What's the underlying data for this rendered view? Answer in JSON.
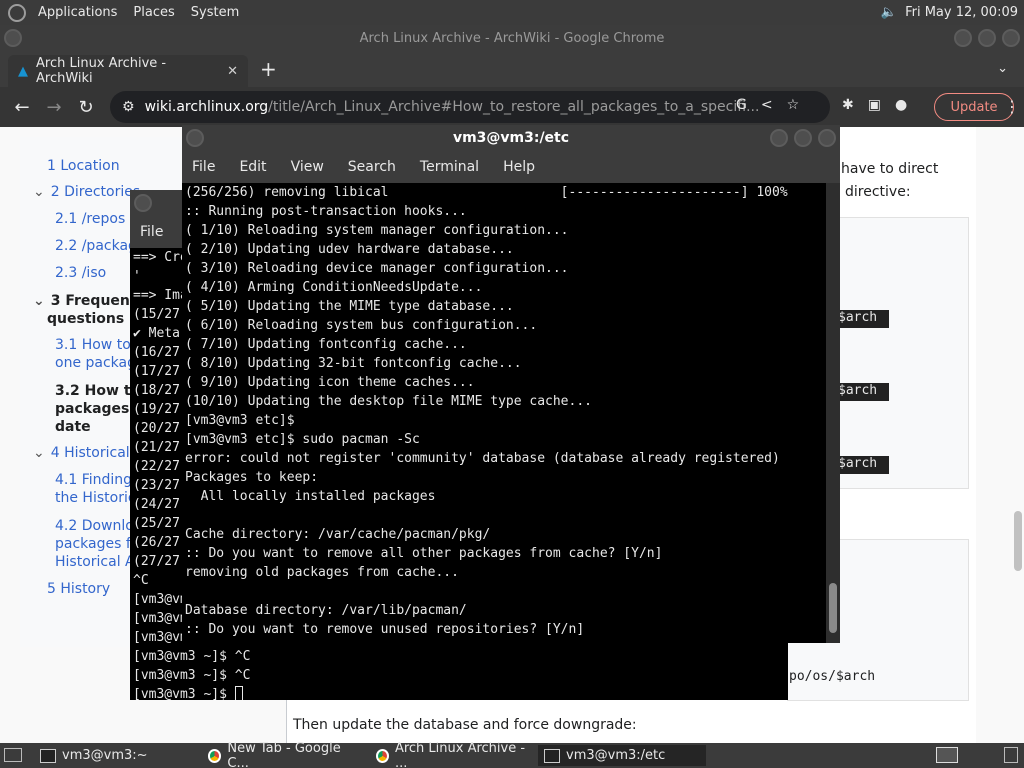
{
  "top_panel": {
    "applications": "Applications",
    "places": "Places",
    "system": "System",
    "clock": "Fri May 12, 00:09"
  },
  "chrome": {
    "window_title": "Arch Linux Archive - ArchWiki - Google Chrome",
    "tab_title": "Arch Linux Archive - ArchWiki",
    "url_host": "wiki.archlinux.org",
    "url_path": "/title/Arch_Linux_Archive#How_to_restore_all_packages_to_a_specifi...",
    "update_label": "Update"
  },
  "toc": [
    {
      "label": "1  Location"
    },
    {
      "label": "2  Directories"
    },
    {
      "label": "2.1  /repos"
    },
    {
      "label": "2.2  /packag"
    },
    {
      "label": "2.3  /iso"
    },
    {
      "label": "3  Frequently"
    },
    {
      "label": "questions"
    },
    {
      "label": "3.1  How to"
    },
    {
      "label": "one packag"
    },
    {
      "label": "3.2  How to"
    },
    {
      "label": "packages t"
    },
    {
      "label": "date"
    },
    {
      "label": "4  Historical A"
    },
    {
      "label": "4.1  Finding"
    },
    {
      "label": "the Historica"
    },
    {
      "label": "4.2  Downlo"
    },
    {
      "label": "packages fr"
    },
    {
      "label": "Historical Ar"
    },
    {
      "label": "5  History"
    }
  ],
  "content": {
    "text1": "have to direct",
    "text2": "directive:",
    "arch1": "$arch",
    "arch2": "$arch",
    "arch3": "$arch",
    "repo_line": "po/os/$arch",
    "bottom_text": "Then update the database and force downgrade:"
  },
  "term_back": {
    "menu_file": "File",
    "lines": [
      "==> Cre",
      "'",
      "==> Ima",
      "(15/27",
      "✔ Meta",
      "(16/27",
      "(17/27",
      "(18/27",
      "(19/27",
      "(20/27",
      "(21/27",
      "(22/27",
      "(23/27",
      "(24/27",
      "(25/27",
      "(26/27",
      "(27/27",
      "^C",
      "[vm3@vm",
      "[vm3@vm",
      "[vm3@vm",
      "[vm3@vm3 ~]$ ^C",
      "[vm3@vm3 ~]$ ^C",
      "[vm3@vm3 ~]$ "
    ]
  },
  "term_front": {
    "title": "vm3@vm3:/etc",
    "menu": [
      "File",
      "Edit",
      "View",
      "Search",
      "Terminal",
      "Help"
    ],
    "lines": [
      "(256/256) removing libical                      [----------------------] 100%",
      ":: Running post-transaction hooks...",
      "( 1/10) Reloading system manager configuration...",
      "( 2/10) Updating udev hardware database...",
      "( 3/10) Reloading device manager configuration...",
      "( 4/10) Arming ConditionNeedsUpdate...",
      "( 5/10) Updating the MIME type database...",
      "( 6/10) Reloading system bus configuration...",
      "( 7/10) Updating fontconfig cache...",
      "( 8/10) Updating 32-bit fontconfig cache...",
      "( 9/10) Updating icon theme caches...",
      "(10/10) Updating the desktop file MIME type cache...",
      "[vm3@vm3 etc]$",
      "[vm3@vm3 etc]$ sudo pacman -Sc",
      "error: could not register 'community' database (database already registered)",
      "Packages to keep:",
      "  All locally installed packages",
      "",
      "Cache directory: /var/cache/pacman/pkg/",
      ":: Do you want to remove all other packages from cache? [Y/n]",
      "removing old packages from cache...",
      "",
      "Database directory: /var/lib/pacman/",
      ":: Do you want to remove unused repositories? [Y/n]"
    ]
  },
  "taskbar": [
    {
      "label": "vm3@vm3:~"
    },
    {
      "label": "New Tab - Google C..."
    },
    {
      "label": "Arch Linux Archive - ..."
    },
    {
      "label": "vm3@vm3:/etc"
    }
  ]
}
